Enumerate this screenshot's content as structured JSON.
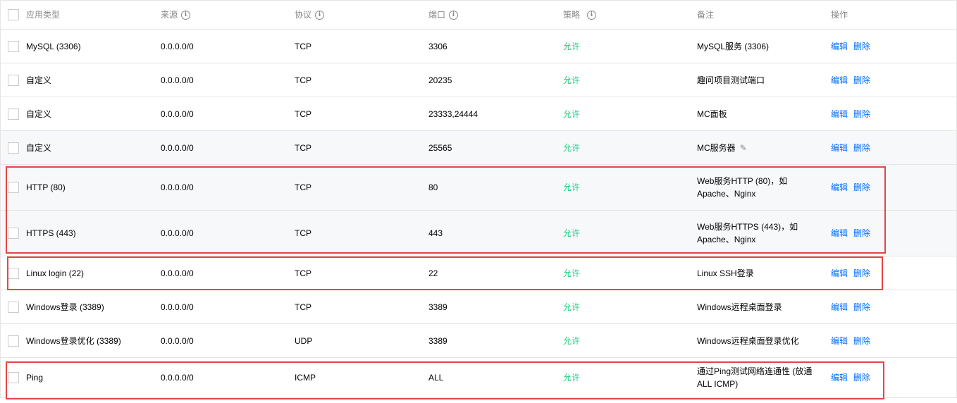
{
  "table": {
    "headers": {
      "type": "应用类型",
      "source": "来源",
      "protocol": "协议",
      "port": "端口",
      "policy": "策略",
      "note": "备注",
      "ops": "操作"
    },
    "info_icon_glyph": "i",
    "edit_link_label": "编辑",
    "delete_link_label": "删除",
    "rows": [
      {
        "type": "MySQL (3306)",
        "source": "0.0.0.0/0",
        "protocol": "TCP",
        "port": "3306",
        "policy": "允许",
        "note": "MySQL服务 (3306)"
      },
      {
        "type": "自定义",
        "source": "0.0.0.0/0",
        "protocol": "TCP",
        "port": "20235",
        "policy": "允许",
        "note": "趣问项目测试端口"
      },
      {
        "type": "自定义",
        "source": "0.0.0.0/0",
        "protocol": "TCP",
        "port": "23333,24444",
        "policy": "允许",
        "note": "MC面板"
      },
      {
        "type": "自定义",
        "source": "0.0.0.0/0",
        "protocol": "TCP",
        "port": "25565",
        "policy": "允许",
        "note": "MC服务器"
      },
      {
        "type": "HTTP (80)",
        "source": "0.0.0.0/0",
        "protocol": "TCP",
        "port": "80",
        "policy": "允许",
        "note": "Web服务HTTP (80)，如Apache、Nginx"
      },
      {
        "type": "HTTPS (443)",
        "source": "0.0.0.0/0",
        "protocol": "TCP",
        "port": "443",
        "policy": "允许",
        "note": "Web服务HTTPS (443)，如Apache、Nginx"
      },
      {
        "type": "Linux login (22)",
        "source": "0.0.0.0/0",
        "protocol": "TCP",
        "port": "22",
        "policy": "允许",
        "note": "Linux SSH登录"
      },
      {
        "type": "Windows登录 (3389)",
        "source": "0.0.0.0/0",
        "protocol": "TCP",
        "port": "3389",
        "policy": "允许",
        "note": "Windows远程桌面登录"
      },
      {
        "type": "Windows登录优化 (3389)",
        "source": "0.0.0.0/0",
        "protocol": "UDP",
        "port": "3389",
        "policy": "允许",
        "note": "Windows远程桌面登录优化"
      },
      {
        "type": "Ping",
        "source": "0.0.0.0/0",
        "protocol": "ICMP",
        "port": "ALL",
        "policy": "允许",
        "note": "通过Ping测试网络连通性 (放通ALL ICMP)"
      }
    ]
  },
  "colors": {
    "policy_allow": "#29cc85",
    "link": "#006eff",
    "highlight_border": "#e54545"
  }
}
